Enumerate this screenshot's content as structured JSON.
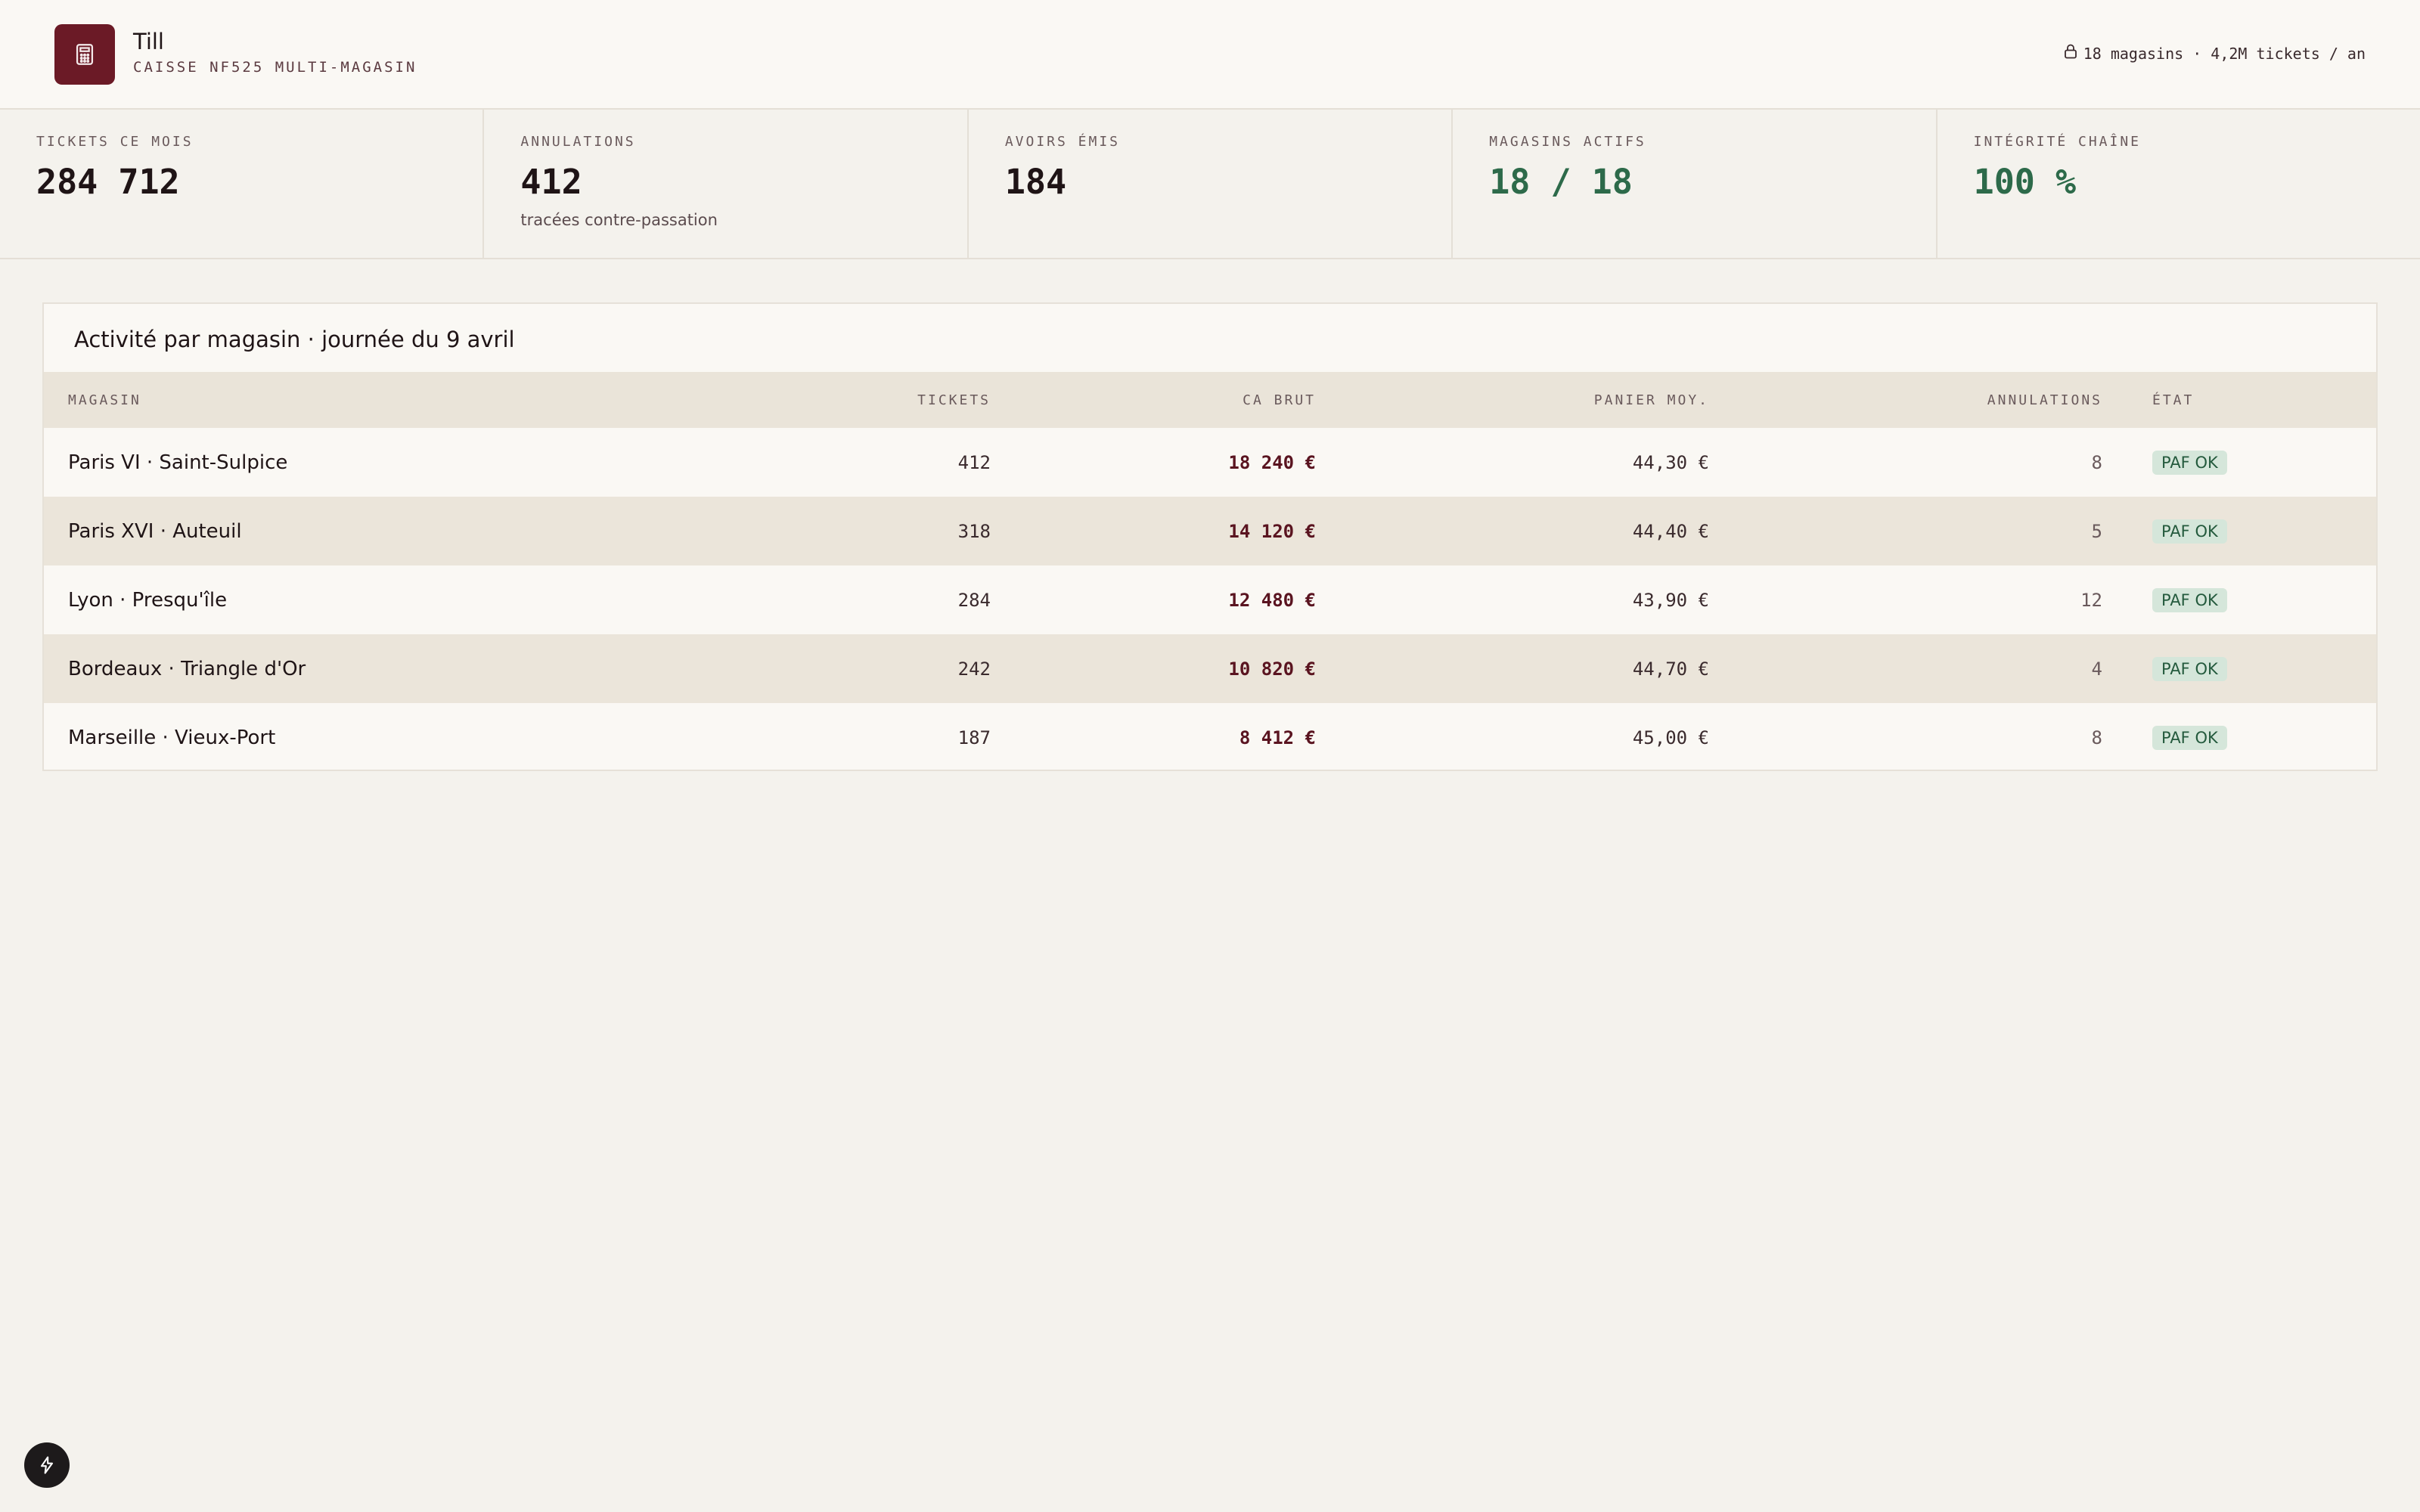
{
  "header": {
    "brand": "Till",
    "subtitle": "CAISSE NF525 MULTI-MAGASIN",
    "meta": "18 magasins · 4,2M tickets / an",
    "meta_icon": "lock-icon",
    "logo_icon": "calculator-icon",
    "brand_color": "#6b1a26"
  },
  "stats": [
    {
      "label": "TICKETS CE MOIS",
      "value": "284 712",
      "note": ""
    },
    {
      "label": "ANNULATIONS",
      "value": "412",
      "note": "tracées contre-passation"
    },
    {
      "label": "AVOIRS ÉMIS",
      "value": "184",
      "note": ""
    },
    {
      "label": "MAGASINS ACTIFS",
      "value": "18 / 18",
      "note": ""
    },
    {
      "label": "INTÉGRITÉ CHAÎNE",
      "value": "100 %",
      "note": ""
    }
  ],
  "activity": {
    "title": "Activité par magasin · journée du 9 avril",
    "columns": {
      "store": "MAGASIN",
      "tickets": "TICKETS",
      "ca": "CA BRUT",
      "basket": "PANIER MOY.",
      "cancellations": "ANNULATIONS",
      "state": "ÉTAT"
    },
    "rows": [
      {
        "store": "Paris VI · Saint-Sulpice",
        "tickets": "412",
        "ca": "18 240 €",
        "basket": "44,30 €",
        "cancellations": "8",
        "state": "PAF OK"
      },
      {
        "store": "Paris XVI · Auteuil",
        "tickets": "318",
        "ca": "14 120 €",
        "basket": "44,40 €",
        "cancellations": "5",
        "state": "PAF OK"
      },
      {
        "store": "Lyon · Presqu'île",
        "tickets": "284",
        "ca": "12 480 €",
        "basket": "43,90 €",
        "cancellations": "12",
        "state": "PAF OK"
      },
      {
        "store": "Bordeaux · Triangle d'Or",
        "tickets": "242",
        "ca": "10 820 €",
        "basket": "44,70 €",
        "cancellations": "4",
        "state": "PAF OK"
      },
      {
        "store": "Marseille · Vieux-Port",
        "tickets": "187",
        "ca": "8 412 €",
        "basket": "45,00 €",
        "cancellations": "8",
        "state": "PAF OK"
      }
    ]
  },
  "fab": {
    "icon": "lightning-icon"
  }
}
